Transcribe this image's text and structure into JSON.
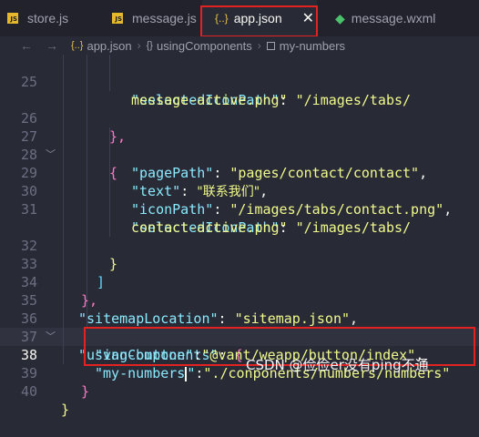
{
  "tabs": [
    {
      "label": "store.js",
      "icon": "js-icon"
    },
    {
      "label": "message.js",
      "icon": "js-icon"
    },
    {
      "label": "app.json",
      "icon": "json-icon",
      "active": true
    },
    {
      "label": "message.wxml",
      "icon": "wxml-icon"
    }
  ],
  "breadcrumb": {
    "file": "app.json",
    "segments": [
      "usingComponents",
      "my-numbers"
    ]
  },
  "line_numbers": [
    "25",
    "26",
    "27",
    "28",
    "29",
    "30",
    "31",
    "32",
    "33",
    "34",
    "35",
    "36",
    "37",
    "38",
    "39",
    "40"
  ],
  "current_line": "38",
  "code": {
    "l25": {
      "key": "\"selectedIconPath\"",
      "punct": ": ",
      "value": "\"/images/tabs/"
    },
    "l25b": {
      "value": "message-active.png\""
    },
    "l26": {
      "brace": "},"
    },
    "l27": {
      "brace": "{"
    },
    "l28": {
      "key": "\"pagePath\"",
      "punct": ": ",
      "value": "\"pages/contact/contact\"",
      "tail": ","
    },
    "l29": {
      "key": "\"text\"",
      "punct": ": ",
      "value": "\"联系我们\"",
      "tail": ","
    },
    "l30": {
      "key": "\"iconPath\"",
      "punct": ": ",
      "value": "\"/images/tabs/contact.png\"",
      "tail": ","
    },
    "l31": {
      "key": "\"selectedIconPath\"",
      "punct": ": ",
      "value": "\"/images/tabs/"
    },
    "l31b": {
      "value": "contact-active.png\""
    },
    "l32": {
      "brace": "}"
    },
    "l33": {
      "brace": "]"
    },
    "l34": {
      "brace": "},"
    },
    "l35": {
      "key": "\"sitemapLocation\"",
      "punct": ": ",
      "value": "\"sitemap.json\"",
      "tail": ","
    },
    "l36": {
      "key": "\"usingComponents\"",
      "punct": ": ",
      "brace": "{"
    },
    "l37": {
      "key": "\"van-button\"",
      "punct": ":",
      "value": "\"@vant/weapp/button/index\"",
      "tail": ","
    },
    "l38": {
      "key_a": "\"my-numbers",
      "key_b": "\"",
      "punct": ":",
      "value": "\"./conponents/numbers/numbers\""
    },
    "l39": {
      "brace": "}"
    },
    "l40": {
      "brace": "}"
    }
  },
  "watermark": "CSDN @俭俭er没有ping不通",
  "colors": {
    "background": "#282a36",
    "key": "#8be9fd",
    "string": "#f1fa8c",
    "highlight_box": "#e32222"
  }
}
